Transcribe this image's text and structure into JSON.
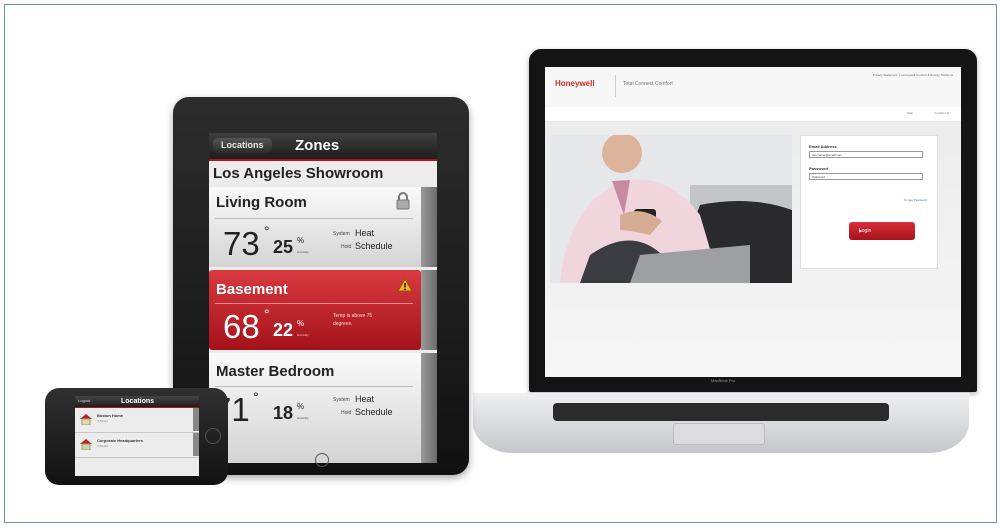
{
  "laptop": {
    "brand": "MacBook Pro",
    "site": {
      "logo": "Honeywell",
      "title": "Total Connect Comfort",
      "top_links": [
        "Privacy Statement",
        "Honeywell Comfort & Energy Solutions"
      ],
      "nav_links": [
        "Help",
        "Contact Us"
      ],
      "login": {
        "email_label": "Email Address",
        "email_value": "username@email.com",
        "password_label": "Password",
        "password_value": "Password",
        "forgot_link": "Forgot Password",
        "button_label": "Login",
        "accent": "#c0151f"
      }
    }
  },
  "tablet": {
    "header": {
      "back_label": "Locations",
      "title": "Zones"
    },
    "location_heading": "Los Angeles Showroom",
    "zones": [
      {
        "name": "Living Room",
        "temp": "73",
        "degree_symbol": "°",
        "humidity": "25",
        "percent_symbol": "%",
        "humidity_label": "Humidity",
        "system_label": "System",
        "system_value": "Heat",
        "hold_label": "Hold",
        "hold_value": "Schedule",
        "icon": "lock-icon",
        "status": "normal"
      },
      {
        "name": "Basement",
        "temp": "68",
        "degree_symbol": "°",
        "humidity": "22",
        "percent_symbol": "%",
        "humidity_label": "Humidity",
        "alert_text": "Temp is above 75 degrees.",
        "icon": "warning-icon",
        "status": "alert",
        "alert_color": "#c41a22"
      },
      {
        "name": "Master Bedroom",
        "temp": "71",
        "degree_symbol": "°",
        "humidity": "18",
        "percent_symbol": "%",
        "humidity_label": "Humidity",
        "system_label": "System",
        "system_value": "Heat",
        "hold_label": "Hold",
        "hold_value": "Schedule",
        "status": "normal"
      }
    ]
  },
  "phone": {
    "header": {
      "back_label": "Logout",
      "title": "Locations"
    },
    "locations": [
      {
        "name": "Boston Home",
        "sub": "4 Zones"
      },
      {
        "name": "Corporate Headquarters",
        "sub": "9 Zones"
      }
    ]
  }
}
